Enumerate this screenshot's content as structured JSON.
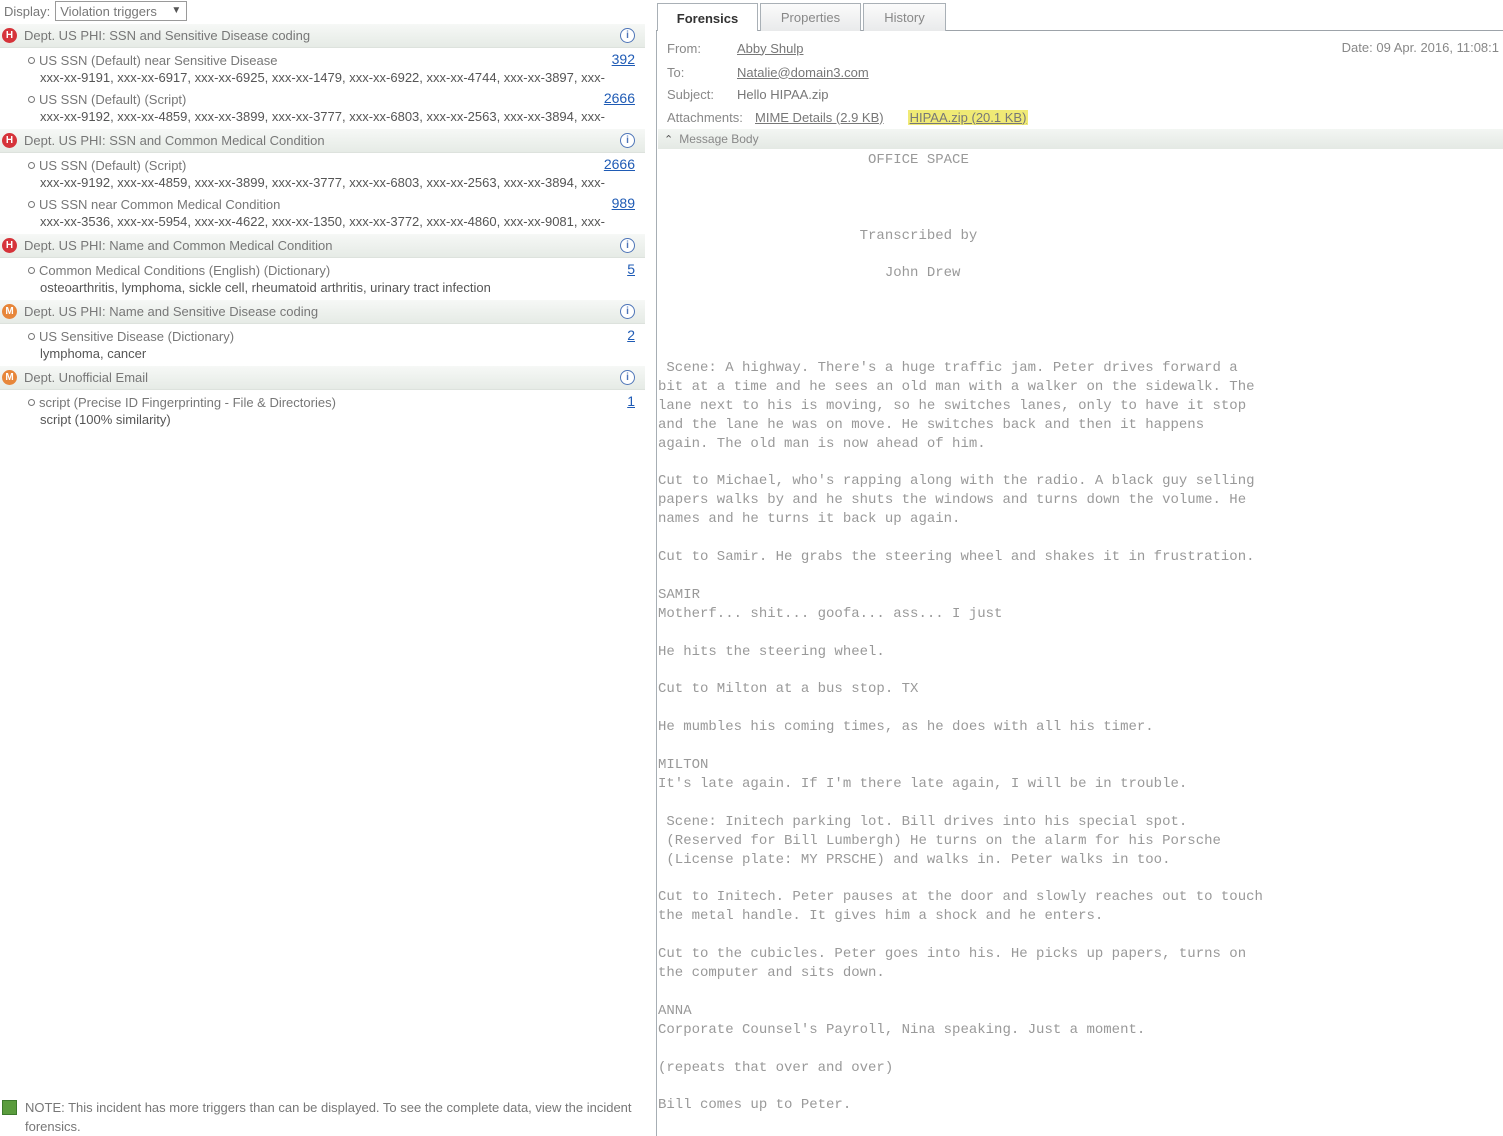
{
  "display": {
    "label": "Display:",
    "selected": "Violation triggers"
  },
  "policies": [
    {
      "severity": "high",
      "title": "Dept. US PHI: SSN and Sensitive Disease coding",
      "rules": [
        {
          "name": "US SSN (Default) near Sensitive Disease",
          "count": "392",
          "matches": "xxx-xx-9191, xxx-xx-6917, xxx-xx-6925, xxx-xx-1479, xxx-xx-6922, xxx-xx-4744, xxx-xx-3897, xxx-"
        },
        {
          "name": "US SSN (Default) (Script)",
          "count": "2666",
          "matches": "xxx-xx-9192, xxx-xx-4859, xxx-xx-3899, xxx-xx-3777, xxx-xx-6803, xxx-xx-2563, xxx-xx-3894, xxx-"
        }
      ]
    },
    {
      "severity": "high",
      "title": "Dept. US PHI: SSN and Common Medical Condition",
      "rules": [
        {
          "name": "US SSN (Default) (Script)",
          "count": "2666",
          "matches": "xxx-xx-9192, xxx-xx-4859, xxx-xx-3899, xxx-xx-3777, xxx-xx-6803, xxx-xx-2563, xxx-xx-3894, xxx-"
        },
        {
          "name": "US SSN near Common Medical Condition",
          "count": "989",
          "matches": "xxx-xx-3536, xxx-xx-5954, xxx-xx-4622, xxx-xx-1350, xxx-xx-3772, xxx-xx-4860, xxx-xx-9081, xxx-"
        }
      ]
    },
    {
      "severity": "high",
      "title": "Dept. US PHI: Name and Common Medical Condition",
      "rules": [
        {
          "name": "Common Medical Conditions (English) (Dictionary)",
          "count": "5",
          "matches": "osteoarthritis, lymphoma, sickle cell, rheumatoid arthritis, urinary tract infection"
        }
      ]
    },
    {
      "severity": "medium",
      "title": "Dept. US PHI: Name and Sensitive Disease coding",
      "rules": [
        {
          "name": "US Sensitive Disease (Dictionary)",
          "count": "2",
          "matches": "lymphoma, cancer"
        }
      ]
    },
    {
      "severity": "medium",
      "title": "Dept. Unofficial Email",
      "rules": [
        {
          "name": "script (Precise ID Fingerprinting - File & Directories)",
          "count": "1",
          "matches": "script (100% similarity)"
        }
      ]
    }
  ],
  "note": {
    "text": "NOTE: This incident has more triggers than can be displayed. To see the complete data, view the incident forensics."
  },
  "tabs": [
    {
      "label": "Forensics",
      "active": true
    },
    {
      "label": "Properties",
      "active": false
    },
    {
      "label": "History",
      "active": false
    }
  ],
  "email": {
    "from_label": "From:",
    "from": "Abby Shulp",
    "to_label": "To:",
    "to": "Natalie@domain3.com",
    "subject_label": "Subject:",
    "subject": "Hello HIPAA.zip",
    "date": "Date: 09 Apr. 2016, 11:08:1",
    "attachments_label": "Attachments:",
    "attachment_1": "MIME Details (2.9 KB)",
    "attachment_2": "HIPAA.zip (20.1 KB)",
    "section_label": "Message Body",
    "body": "                         OFFICE SPACE\n\n\n\n                        Transcribed by\n\n                           John Drew\n\n\n\n\n Scene: A highway. There's a huge traffic jam. Peter drives forward a\nbit at a time and he sees an old man with a walker on the sidewalk. The\nlane next to his is moving, so he switches lanes, only to have it stop\nand the lane he was on move. He switches back and then it happens\nagain. The old man is now ahead of him.\n\nCut to Michael, who's rapping along with the radio. A black guy selling\npapers walks by and he shuts the windows and turns down the volume. He\nnames and he turns it back up again.\n\nCut to Samir. He grabs the steering wheel and shakes it in frustration.\n\nSAMIR\nMotherf... shit... goofa... ass... I just\n\nHe hits the steering wheel.\n\nCut to Milton at a bus stop. TX\n\nHe mumbles his coming times, as he does with all his timer.\n\nMILTON\nIt's late again. If I'm there late again, I will be in trouble.\n\n Scene: Initech parking lot. Bill drives into his special spot.\n (Reserved for Bill Lumbergh) He turns on the alarm for his Porsche\n (License plate: MY PRSCHE) and walks in. Peter walks in too.\n\nCut to Initech. Peter pauses at the door and slowly reaches out to touch\nthe metal handle. It gives him a shock and he enters.\n\nCut to the cubicles. Peter goes into his. He picks up papers, turns on\nthe computer and sits down.\n\nANNA\nCorporate Counsel's Payroll, Nina speaking. Just a moment.\n\n(repeats that over and over)\n\nBill comes up to Peter.\n\nBILL"
  }
}
